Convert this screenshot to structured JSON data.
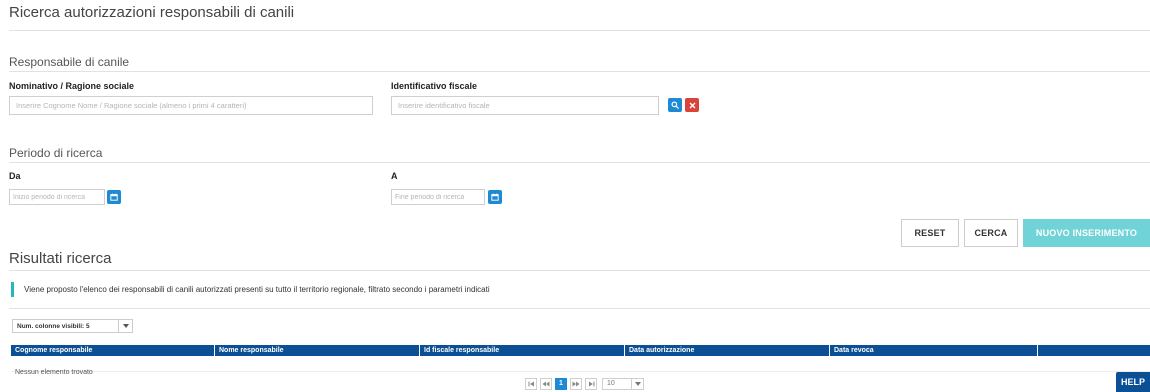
{
  "page": {
    "title": "Ricerca autorizzazioni responsabili di canili"
  },
  "responsabile": {
    "section_title": "Responsabile di canile",
    "nominativo_label": "Nominativo / Ragione sociale",
    "nominativo_placeholder": "Inserire Cognome Nome / Ragione sociale (almeno i primi 4 caratteri)",
    "nominativo_value": "",
    "id_fiscale_label": "Identificativo fiscale",
    "id_fiscale_placeholder": "Inserire identificativo fiscale",
    "id_fiscale_value": ""
  },
  "periodo": {
    "section_title": "Periodo di ricerca",
    "da_label": "Da",
    "da_placeholder": "Inizio periodo di ricerca",
    "a_label": "A",
    "a_placeholder": "Fine periodo di ricerca"
  },
  "actions": {
    "reset_label": "RESET",
    "cerca_label": "CERCA",
    "nuovo_label": "NUOVO INSERIMENTO"
  },
  "results": {
    "title": "Risultati ricerca",
    "info_text": "Viene proposto l'elenco dei responsabili di canili autorizzati presenti su tutto il territorio regionale, filtrato secondo i parametri indicati",
    "visible_columns_label": "Num. colonne visibili: 5",
    "columns": [
      "Cognome responsabile",
      "Nome responsabile",
      "Id fiscale responsabile",
      "Data autorizzazione",
      "Data revoca",
      ""
    ],
    "empty_text": "Nessun elemento trovato",
    "pager": {
      "current_page": "1",
      "page_size": "10"
    }
  },
  "help": {
    "label": "HELP"
  },
  "colors": {
    "header_blue": "#0b4f94",
    "action_blue": "#1f8ad4",
    "clear_red": "#d9443a",
    "accent_teal": "#6fd3d8",
    "info_bar": "#20b8c2"
  },
  "icons": {
    "search": "search-icon",
    "clear": "close-icon",
    "calendar": "calendar-icon",
    "dropdown": "caret-down-icon",
    "first": "first-page-icon",
    "prev": "prev-page-icon",
    "next": "next-page-icon",
    "last": "last-page-icon"
  }
}
